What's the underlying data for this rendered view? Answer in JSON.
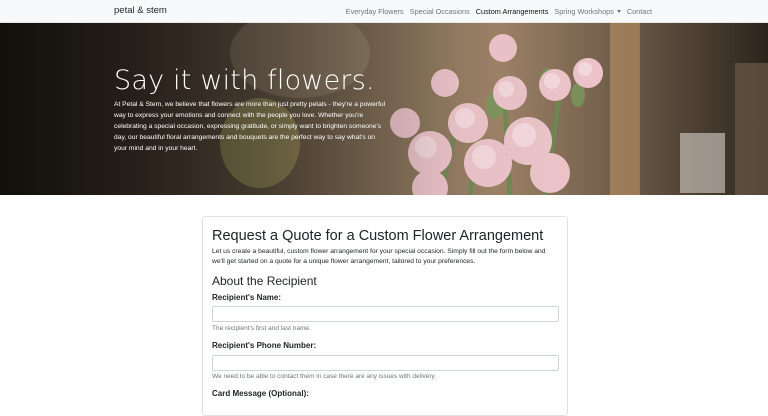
{
  "navbar": {
    "brand": "petal & stem",
    "links": [
      {
        "label": "Everyday Flowers",
        "active": false
      },
      {
        "label": "Special Occasions",
        "active": false
      },
      {
        "label": "Custom Arrangements",
        "active": true
      },
      {
        "label": "Spring Workshops",
        "active": false,
        "dropdown": true
      },
      {
        "label": "Contact",
        "active": false
      }
    ]
  },
  "hero": {
    "title": "Say it with flowers.",
    "text": "At Petal & Stem, we believe that flowers are more than just pretty petals - they're a powerful way to express your emotions and connect with the people you love. Whether you're celebrating a special occasion, expressing gratitude, or simply want to brighten someone's day, our beautiful floral arrangements and bouquets are the perfect way to say what's on your mind and in your heart."
  },
  "form": {
    "title": "Request a Quote for a Custom Flower Arrangement",
    "intro": "Let us create a beautiful, custom flower arrangement for your special occasion. Simply fill out the form below and we'll get started on a quote for a unique flower arrangement, tailored to your preferences.",
    "section_title": "About the Recipient",
    "recipient_name": {
      "label": "Recipient's Name:",
      "value": "",
      "help": "The recipient's first and last name."
    },
    "recipient_phone": {
      "label": "Recipient's Phone Number:",
      "value": "",
      "help": "We need to be able to contact them in case there are any issues with delivery."
    },
    "card_message": {
      "label": "Card Message (Optional):"
    }
  }
}
